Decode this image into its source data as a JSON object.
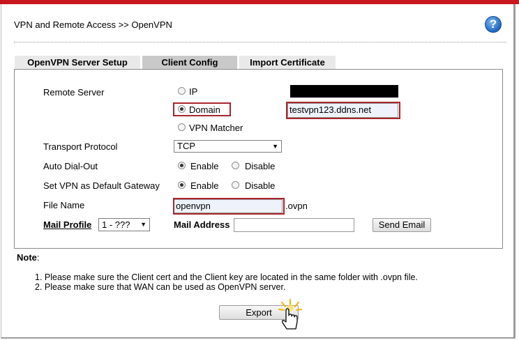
{
  "header": {
    "title": "VPN and Remote Access >> OpenVPN",
    "help_symbol": "?"
  },
  "tabs": [
    {
      "label": "OpenVPN Server Setup",
      "active": false
    },
    {
      "label": "Client Config",
      "active": true
    },
    {
      "label": "Import Certificate",
      "active": false
    }
  ],
  "form": {
    "remote_server": {
      "label": "Remote Server",
      "options": [
        {
          "label": "IP",
          "checked": false
        },
        {
          "label": "Domain",
          "checked": true
        },
        {
          "label": "VPN Matcher",
          "checked": false
        }
      ],
      "domain_value": "testvpn123.ddns.net"
    },
    "transport_protocol": {
      "label": "Transport Protocol",
      "value": "TCP"
    },
    "auto_dial_out": {
      "label": "Auto Dial-Out",
      "enable": "Enable",
      "disable": "Disable",
      "selected": "Enable"
    },
    "default_gateway": {
      "label": "Set VPN as Default Gateway",
      "enable": "Enable",
      "disable": "Disable",
      "selected": "Enable"
    },
    "file_name": {
      "label": "File Name",
      "value": "openvpn",
      "suffix": ".ovpn"
    },
    "mail_profile": {
      "label": "Mail Profile",
      "value": "1 - ???"
    },
    "mail_address": {
      "label": "Mail Address",
      "value": ""
    },
    "send_email_label": "Send Email"
  },
  "note": {
    "title": "Note",
    "colon": ":",
    "items": [
      "1. Please make sure the Client cert and the Client key are located in the same folder with .ovpn file.",
      "2. Please make sure that WAN can be used as OpenVPN server."
    ]
  },
  "export_label": "Export",
  "colors": {
    "accent_red": "#c8161c",
    "highlight_border": "#a8242d",
    "tab_active": "#c9c9c9",
    "tab_inactive": "#e9e9e9"
  }
}
